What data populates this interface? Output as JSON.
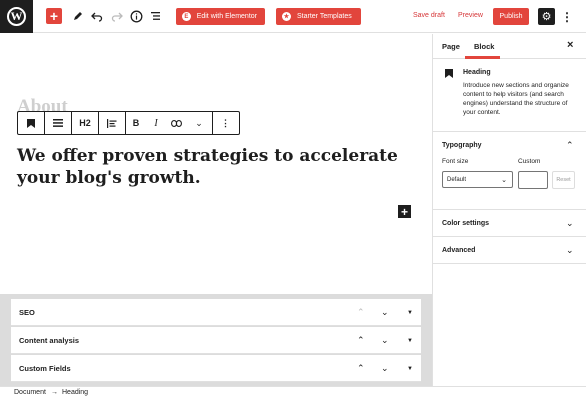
{
  "topbar": {
    "logo_letter": "W",
    "edit_elementor_label": "Edit with Elementor",
    "starter_templates_label": "Starter Templates",
    "save_draft_label": "Save draft",
    "preview_label": "Preview",
    "publish_label": "Publish"
  },
  "editor": {
    "faded_heading": "About",
    "block_toolbar": {
      "heading_level": "H2",
      "bold": "B",
      "italic": "I"
    },
    "heading_text": "We offer proven strategies to accelerate your blog's growth."
  },
  "metaboxes": [
    {
      "title": "SEO"
    },
    {
      "title": "Content analysis"
    },
    {
      "title": "Custom Fields"
    }
  ],
  "breadcrumb": {
    "document": "Document",
    "separator": "→",
    "current": "Heading"
  },
  "sidebar": {
    "tabs": [
      "Page",
      "Block"
    ],
    "active_tab": "Block",
    "block_card": {
      "title": "Heading",
      "description": "Introduce new sections and organize content to help visitors (and search engines) understand the structure of your content."
    },
    "typography": {
      "title": "Typography",
      "font_size_label": "Font size",
      "custom_label": "Custom",
      "select_value": "Default",
      "reset_label": "Reset"
    },
    "color_settings_title": "Color settings",
    "advanced_title": "Advanced"
  },
  "colors": {
    "accent": "#e2453c",
    "dark": "#1e1e1e"
  }
}
